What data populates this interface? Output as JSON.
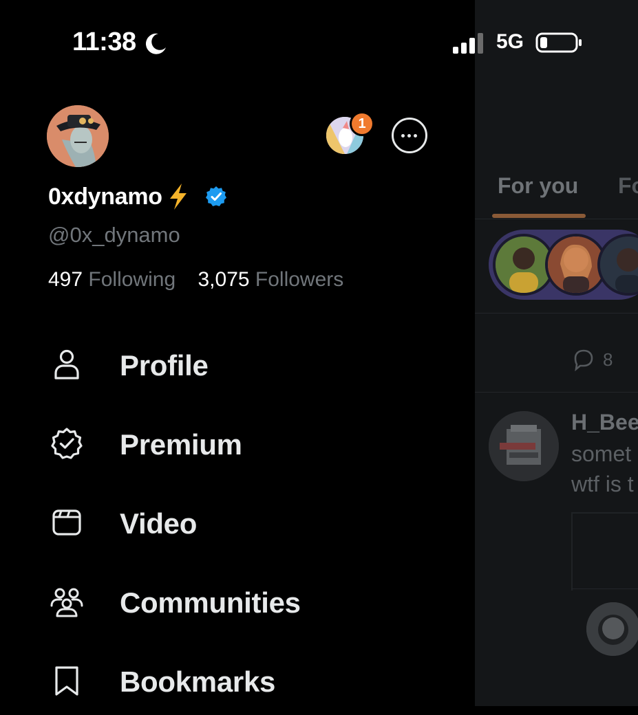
{
  "status_bar": {
    "time": "11:38",
    "network": "5G",
    "icons": [
      "moon-icon",
      "signal-icon",
      "battery-icon"
    ]
  },
  "drawer": {
    "display_name": "0xdynamo",
    "handle": "@0x_dynamo",
    "following_count": "497",
    "following_label": "Following",
    "followers_count": "3,075",
    "followers_label": "Followers",
    "account_badge_count": "1",
    "menu": [
      {
        "label": "Profile",
        "icon": "person-icon"
      },
      {
        "label": "Premium",
        "icon": "verified-badge-icon"
      },
      {
        "label": "Video",
        "icon": "video-icon"
      },
      {
        "label": "Communities",
        "icon": "communities-icon"
      },
      {
        "label": "Bookmarks",
        "icon": "bookmark-icon"
      }
    ]
  },
  "feed": {
    "tabs": [
      "For you",
      "Fo"
    ],
    "reply_count": "8",
    "post": {
      "author": "H_Bee",
      "lines": [
        "somet",
        "wtf is t"
      ]
    }
  },
  "colors": {
    "background": "#000000",
    "text_primary": "#e7e9ea",
    "text_secondary": "#71767b",
    "verified_blue": "#1d9bf0",
    "badge_orange": "#f07a2e",
    "bolt_yellow": "#f5b32a"
  }
}
